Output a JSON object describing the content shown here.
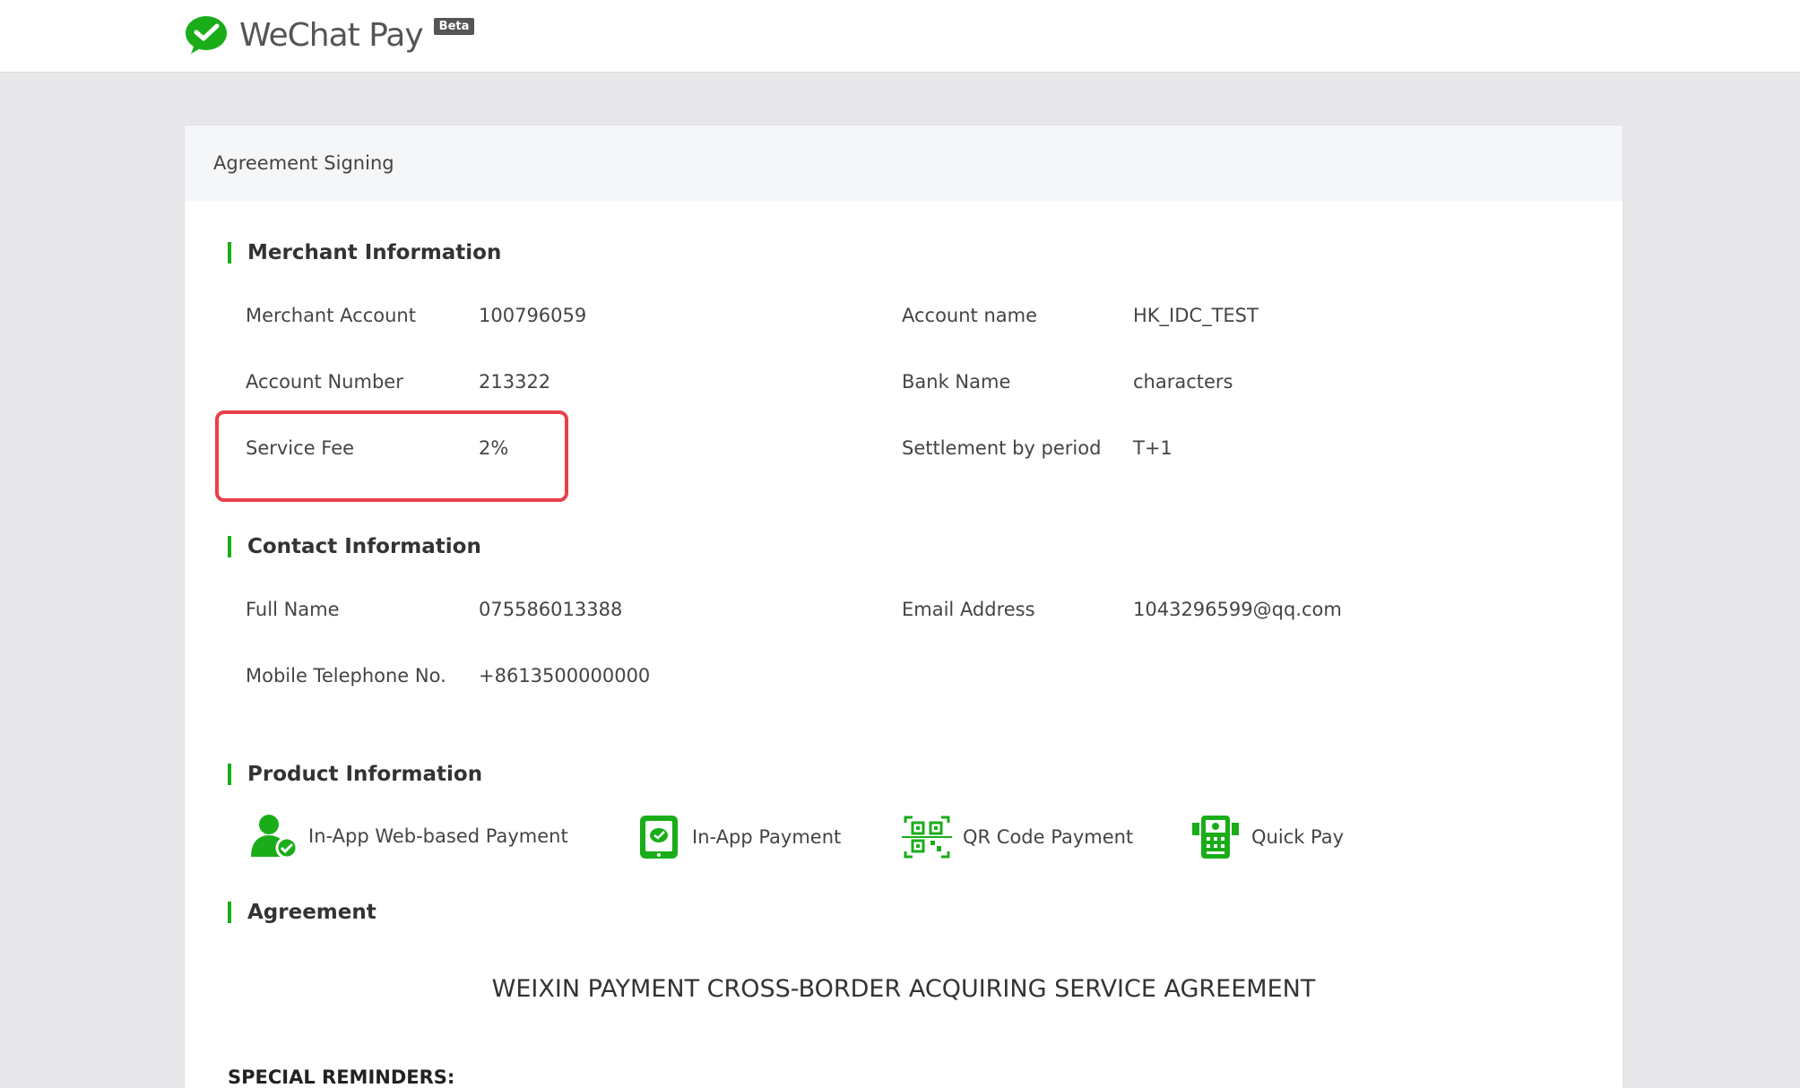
{
  "header": {
    "brand": "WeChat Pay",
    "badge": "Beta"
  },
  "card": {
    "title": "Agreement Signing"
  },
  "merchant": {
    "title": "Merchant Information",
    "merchant_account_label": "Merchant Account",
    "merchant_account_value": "100796059",
    "account_name_label": "Account name",
    "account_name_value": "HK_IDC_TEST",
    "account_number_label": "Account Number",
    "account_number_value": "213322",
    "bank_name_label": "Bank Name",
    "bank_name_value": "characters",
    "service_fee_label": "Service Fee",
    "service_fee_value": "2%",
    "settlement_label": "Settlement by period",
    "settlement_value": "T+1"
  },
  "contact": {
    "title": "Contact Information",
    "full_name_label": "Full Name",
    "full_name_value": "075586013388",
    "email_label": "Email Address",
    "email_value": "1043296599@qq.com",
    "mobile_label": "Mobile Telephone No.",
    "mobile_value": "+8613500000000"
  },
  "product": {
    "title": "Product Information",
    "items": [
      {
        "label": "In-App Web-based Payment",
        "icon": "user-check-icon"
      },
      {
        "label": "In-App Payment",
        "icon": "phone-wechat-icon"
      },
      {
        "label": "QR Code Payment",
        "icon": "qr-code-icon"
      },
      {
        "label": "Quick Pay",
        "icon": "pos-terminal-icon"
      }
    ]
  },
  "agreement": {
    "title": "Agreement",
    "doc_title": "WEIXIN PAYMENT CROSS-BORDER ACQUIRING SERVICE AGREEMENT",
    "reminders": "SPECIAL REMINDERS:"
  },
  "colors": {
    "accent": "#1aad19",
    "highlight": "#e8404a"
  }
}
